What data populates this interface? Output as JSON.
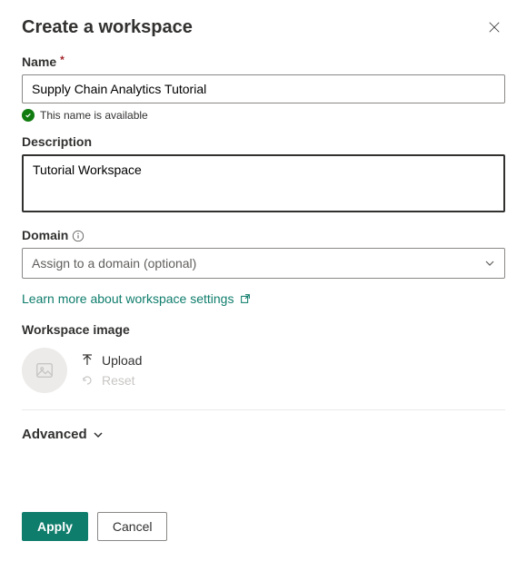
{
  "header": {
    "title": "Create a workspace"
  },
  "name": {
    "label": "Name",
    "value": "Supply Chain Analytics Tutorial",
    "validation_message": "This name is available"
  },
  "description": {
    "label": "Description",
    "value": "Tutorial Workspace"
  },
  "domain": {
    "label": "Domain",
    "placeholder": "Assign to a domain (optional)"
  },
  "learn_more": "Learn more about workspace settings",
  "workspace_image": {
    "label": "Workspace image",
    "upload": "Upload",
    "reset": "Reset"
  },
  "advanced": {
    "label": "Advanced"
  },
  "footer": {
    "apply": "Apply",
    "cancel": "Cancel"
  }
}
